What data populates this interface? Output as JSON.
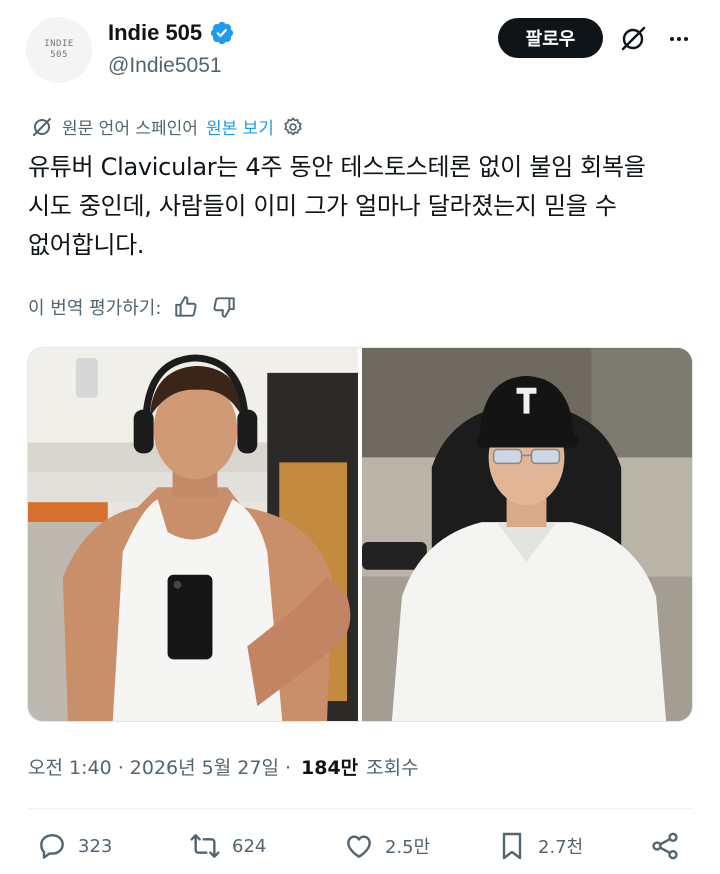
{
  "author": {
    "avatar_text_line1": "INDIE",
    "avatar_text_line2": "505",
    "display_name": "Indie 505",
    "handle": "@Indie5051"
  },
  "header": {
    "follow_label": "팔로우"
  },
  "translation": {
    "original_language": "원문 언어 스페인어",
    "view_original": "원본 보기"
  },
  "tweet": {
    "text": "유튜버 Clavicular는 4주 동안 테스토스테론 없이 불임 회복을 시도 중인데, 사람들이 이미 그가 얼마나 달라졌는지 믿을 수 없어합니다."
  },
  "rating": {
    "label": "이 번역 평가하기:"
  },
  "meta": {
    "time": "오전 1:40 · 2026년 5월 27일 ·",
    "views_count": "184만",
    "views_label": "조회수"
  },
  "actions": {
    "replies": "323",
    "reposts": "624",
    "likes": "2.5만",
    "bookmarks": "2.7천"
  },
  "colors": {
    "accent": "#1d9bf0",
    "text_primary": "#0f1419",
    "text_secondary": "#536471"
  }
}
